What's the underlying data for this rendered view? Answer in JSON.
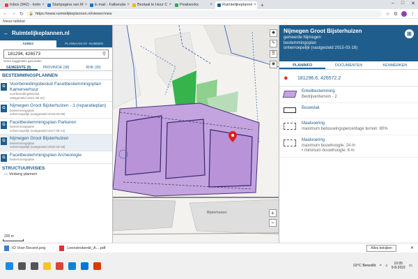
{
  "browser": {
    "tabs": [
      {
        "label": "Inbox (842) - kolm",
        "color": "#ea4335",
        "active": false
      },
      {
        "label": "Startpagina van M",
        "color": "#1a73e8",
        "active": false
      },
      {
        "label": "E-mail - Falkensta",
        "color": "#0078d4",
        "active": false
      },
      {
        "label": "Bestaal te Huur C",
        "color": "#f4b400",
        "active": false
      },
      {
        "label": "Peakworks",
        "color": "#34a853",
        "active": false
      },
      {
        "label": "Ruimtelijkeplanne",
        "color": "#1f5d8c",
        "active": true
      }
    ],
    "new_tab": "+",
    "url": "https://www.ruimtelijkeplannen.nl/viewer/view",
    "bookmarks_label": "Nieuw tabblad"
  },
  "left_panel": {
    "title": "Ruimtelijkeplannen.nl",
    "search_tabs": [
      "Adres",
      "Plannaam of -nummer"
    ],
    "search_value": "181294, 426573",
    "hint": "Geen suggesties gevonden",
    "result_tabs": [
      "Gemeente (8)",
      "Provincie (38)",
      "Rijk (26)"
    ],
    "section_title": "Bestemmingsplannen",
    "plans": [
      {
        "badge": "G",
        "name": "Voorbereidingsbesluit Facetbestemmingsplan Kamerverhuur",
        "sub1": "voorbereidingsbesluit",
        "sub2": "vastgesteld (2021-09-22)",
        "selected": false
      },
      {
        "badge": "G",
        "name": "Nijmegen Groot Bijsterhuizen - 1 (reparatieplan)",
        "sub1": "bestemmingsplan",
        "sub2": "onherroepelijk (vastgesteld 2019-05-08)",
        "selected": false
      },
      {
        "badge": "G",
        "name": "Facetbestemmingsplan Parkeren",
        "sub1": "bestemmingsplan",
        "sub2": "onherroepelijk (vastgesteld 2017-09-13)",
        "selected": false
      },
      {
        "badge": "G",
        "name": "Nijmegen Groot Bijsterhuizen",
        "sub1": "bestemmingsplan",
        "sub2": "onherroepelijk (vastgesteld 2015-03-18)",
        "selected": true
      },
      {
        "badge": "G",
        "name": "Facetbestemmingsplan Archeologie",
        "sub1": "bestemmingsplan",
        "sub2": "",
        "selected": false
      }
    ],
    "structuur_title": "Structuurvisies",
    "verberg": "Verberg plannen",
    "scale": "200 m"
  },
  "map": {
    "controls": [
      "layers-icon",
      "draw-icon",
      "list-icon",
      "info-icon"
    ],
    "zoom_in": "+",
    "zoom_out": "−",
    "street_label": "Bijsterhuizen"
  },
  "right_panel": {
    "title": "Nijmegen Groot Bijsterhuizen",
    "sub1": "gemeente Nijmegen",
    "sub2": "bestemmingsplan",
    "sub3": "onherroepelijk (vastgesteld 2015-03-18)",
    "tabs": [
      "Planinfo",
      "Documenten",
      "Kenmerken"
    ],
    "coord": "181296.6, 426572.2",
    "legend": [
      {
        "swatch": "purple",
        "title": "Enkelbestemming",
        "sub": "Bedrijventerrein - 2"
      },
      {
        "swatch": "bouwvlak",
        "title": "Bouwvlak",
        "sub": ""
      },
      {
        "swatch": "dash",
        "title": "Maatvoering",
        "sub": "maximum bebouwingspercentage terrein: 80%"
      },
      {
        "swatch": "dash",
        "title": "Maatvoering",
        "sub": "maximum bouwhoogte: 24 m\n• minimum bouwhoogte: 6 m"
      }
    ]
  },
  "downloads": {
    "items": [
      {
        "name": "IO Voor Recent.png",
        "type": "img"
      },
      {
        "name": "Loonstrokenkt_A....pdf",
        "type": "pdf"
      }
    ],
    "show_all": "Alles bekijken",
    "close": "✕"
  },
  "taskbar": {
    "weather": "19°C  Bewolkt",
    "time": "10:05",
    "date": "9-8-2022",
    "apps": [
      {
        "name": "windows-icon",
        "color": "#1e88e5"
      },
      {
        "name": "search-icon",
        "color": "#555"
      },
      {
        "name": "taskview-icon",
        "color": "#555"
      },
      {
        "name": "explorer-icon",
        "color": "#f4c430"
      },
      {
        "name": "chrome-icon",
        "color": "#db4437"
      },
      {
        "name": "edge-icon",
        "color": "#0a84d6"
      },
      {
        "name": "mail-icon",
        "color": "#0078d4"
      },
      {
        "name": "office-icon",
        "color": "#d83b01"
      }
    ]
  }
}
